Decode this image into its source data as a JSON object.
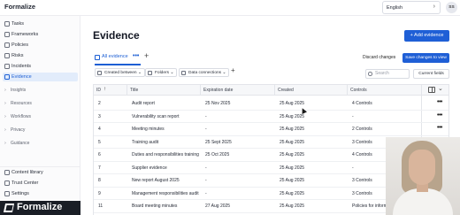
{
  "app": {
    "name": "Formalize",
    "language": "English",
    "user_initials": "SS"
  },
  "sidebar": {
    "items": [
      {
        "label": "Tasks",
        "icon": "check-square-icon"
      },
      {
        "label": "Frameworks",
        "icon": "layers-icon"
      },
      {
        "label": "Policies",
        "icon": "shield-icon"
      },
      {
        "label": "Risks",
        "icon": "alert-triangle-icon"
      },
      {
        "label": "Incidents",
        "icon": "flag-icon"
      },
      {
        "label": "Evidence",
        "icon": "file-check-icon",
        "active": true
      }
    ],
    "groups": [
      "Insights",
      "Resources",
      "Workflows",
      "Privacy",
      "Guidance"
    ],
    "footer_items": [
      {
        "label": "Content library",
        "icon": "book-icon"
      },
      {
        "label": "Trust Center",
        "icon": "globe-icon"
      },
      {
        "label": "Settings",
        "icon": "gear-icon"
      }
    ],
    "footer_logo_text": "Formalize"
  },
  "main": {
    "title": "Evidence",
    "add_button": "+ Add evidence",
    "tab_label": "All evidence",
    "tab_menu": "•••",
    "tab_add": "+",
    "discard_label": "Discard changes",
    "save_label": "Save changes to view",
    "filters": [
      "Created between",
      "Folders",
      "Data connections"
    ],
    "filter_add": "+",
    "search_placeholder": "Search",
    "current_fields_label": "Current fields"
  },
  "table": {
    "columns": [
      "ID",
      "Title",
      "Expiration date",
      "Created",
      "Controls"
    ],
    "rows": [
      {
        "id": "2",
        "title": "Audit report",
        "expiration": "25 Nov 2025",
        "created": "25 Aug 2025",
        "controls": "4 Controls"
      },
      {
        "id": "3",
        "title": "Vulnerability scan report",
        "expiration": "-",
        "created": "25 Aug 2025",
        "controls": "-"
      },
      {
        "id": "4",
        "title": "Meeting minutes",
        "expiration": "-",
        "created": "25 Aug 2025",
        "controls": "2 Controls"
      },
      {
        "id": "5",
        "title": "Training audit",
        "expiration": "25 Sept 2025",
        "created": "25 Aug 2025",
        "controls": "3 Controls"
      },
      {
        "id": "6",
        "title": "Duties and responsibilities training",
        "expiration": "25 Oct 2025",
        "created": "25 Aug 2025",
        "controls": "4 Controls"
      },
      {
        "id": "7",
        "title": "Supplier evidence",
        "expiration": "-",
        "created": "25 Aug 2025",
        "controls": "-"
      },
      {
        "id": "8",
        "title": "New report August 2025",
        "expiration": "-",
        "created": "25 Aug 2025",
        "controls": "3 Controls"
      },
      {
        "id": "9",
        "title": "Management responsibilities audit",
        "expiration": "-",
        "created": "25 Aug 2025",
        "controls": "3 Controls"
      },
      {
        "id": "11",
        "title": "Board meeting minutes",
        "expiration": "27 Aug 2025",
        "created": "25 Aug 2025",
        "controls": "Policies for information security"
      }
    ],
    "row_menu": "•••"
  },
  "colors": {
    "accent": "#1f5fd6",
    "active_bg": "#e2ecfb",
    "footer_bg": "#1a1e26"
  }
}
